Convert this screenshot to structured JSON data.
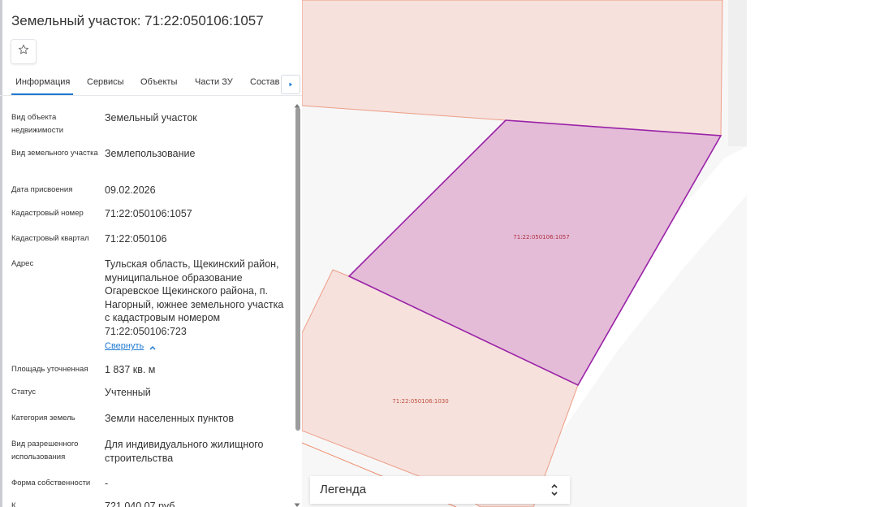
{
  "panel": {
    "title": "Земельный участок: 71:22:050106:1057",
    "favorite_icon": "star-outline-icon",
    "tabs": [
      {
        "label": "Информация",
        "active": true
      },
      {
        "label": "Сервисы",
        "active": false
      },
      {
        "label": "Объекты",
        "active": false
      },
      {
        "label": "Части ЗУ",
        "active": false
      },
      {
        "label": "Состав",
        "active": false
      }
    ],
    "fields": [
      {
        "label": "Вид объекта недвижимости",
        "value": "Земельный участок"
      },
      {
        "label": "Вид земельного участка",
        "value": "Землепользование"
      },
      {
        "label": "Дата присвоения",
        "value": "09.02.2026"
      },
      {
        "label": "Кадастровый номер",
        "value": "71:22:050106:1057"
      },
      {
        "label": "Кадастровый квартал",
        "value": "71:22:050106"
      },
      {
        "label": "Адрес",
        "value": "Тульская область, Щекинский район, муниципальное образование Огаревское Щекинского района, п. Нагорный, южнее земельного участка с кадастровым номером 71:22:050106:723"
      },
      {
        "label": "Площадь уточненная",
        "value": "1 837 кв. м"
      },
      {
        "label": "Статус",
        "value": "Учтенный"
      },
      {
        "label": "Категория земель",
        "value": "Земли населенных пунктов"
      },
      {
        "label": "Вид разрешенного использования",
        "value": "Для индивидуального жилищного строительства"
      },
      {
        "label": "Форма собственности",
        "value": "-"
      },
      {
        "label": "К",
        "value": "721 040,07 руб"
      }
    ],
    "collapse_label": "Свернуть"
  },
  "map": {
    "parcels": [
      {
        "id": "71:22:050106:1057",
        "selected": true
      },
      {
        "id": "71:22:050106:1030",
        "selected": false
      }
    ],
    "colors": {
      "selected_fill": "#e4bcd8",
      "selected_stroke": "#9a22a8",
      "parcel_fill": "#f6e1dc",
      "parcel_stroke": "#ee9d86",
      "road": "#ffffff"
    }
  },
  "legend": {
    "label": "Легенда",
    "toggle_icon": "expand-collapse-icon"
  }
}
